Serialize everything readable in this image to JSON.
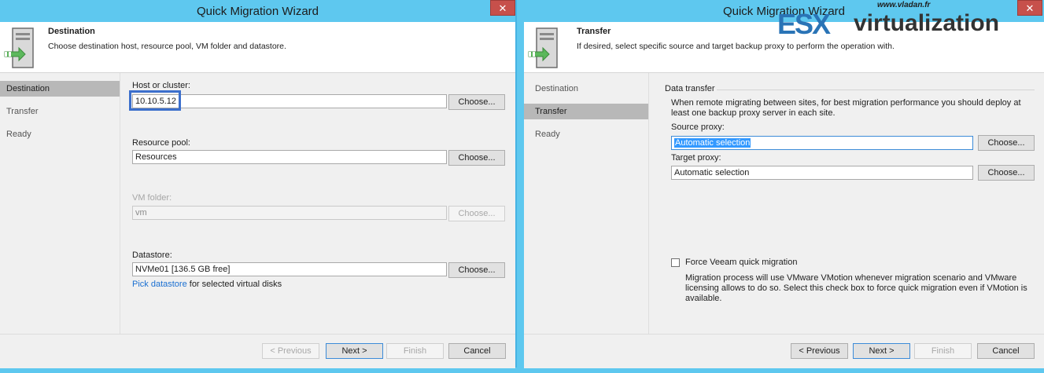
{
  "left": {
    "title": "Quick Migration Wizard",
    "close": "✕",
    "header": {
      "title": "Destination",
      "desc": "Choose destination host, resource pool, VM folder and datastore."
    },
    "nav": [
      "Destination",
      "Transfer",
      "Ready"
    ],
    "fields": {
      "host_label": "Host or cluster:",
      "host_value": "10.10.5.12",
      "pool_label": "Resource pool:",
      "pool_value": "Resources",
      "folder_label": "VM folder:",
      "folder_value": "vm",
      "ds_label": "Datastore:",
      "ds_value": "NVMe01 [136.5 GB free]",
      "pick_link": "Pick datastore",
      "pick_suffix": " for selected virtual disks",
      "choose": "Choose..."
    },
    "buttons": {
      "previous": "< Previous",
      "next": "Next >",
      "finish": "Finish",
      "cancel": "Cancel"
    }
  },
  "right": {
    "title": "Quick Migration Wizard",
    "close": "✕",
    "header": {
      "title": "Transfer",
      "desc": "If desired, select specific source and target backup proxy to perform the operation with."
    },
    "nav": [
      "Destination",
      "Transfer",
      "Ready"
    ],
    "group_title": "Data transfer",
    "info": "When remote migrating between sites, for best migration performance you should deploy at least one backup proxy server in each site.",
    "source_label": "Source proxy:",
    "source_value": "Automatic selection",
    "target_label": "Target proxy:",
    "target_value": "Automatic selection",
    "choose": "Choose...",
    "force_label": "Force Veeam quick migration",
    "force_desc": "Migration process will use VMware VMotion whenever migration scenario and VMware licensing allows to do so. Select this check box to force quick migration even if VMotion is available.",
    "buttons": {
      "previous": "< Previous",
      "next": "Next >",
      "finish": "Finish",
      "cancel": "Cancel"
    }
  },
  "watermark": {
    "url": "www.vladan.fr",
    "es": "ESX",
    "rest": "virtualization"
  },
  "colors": {
    "titlebar": "#5ec8ef",
    "close": "#c7504b",
    "link": "#1a6fd1",
    "highlight": "#3c6fcc"
  }
}
